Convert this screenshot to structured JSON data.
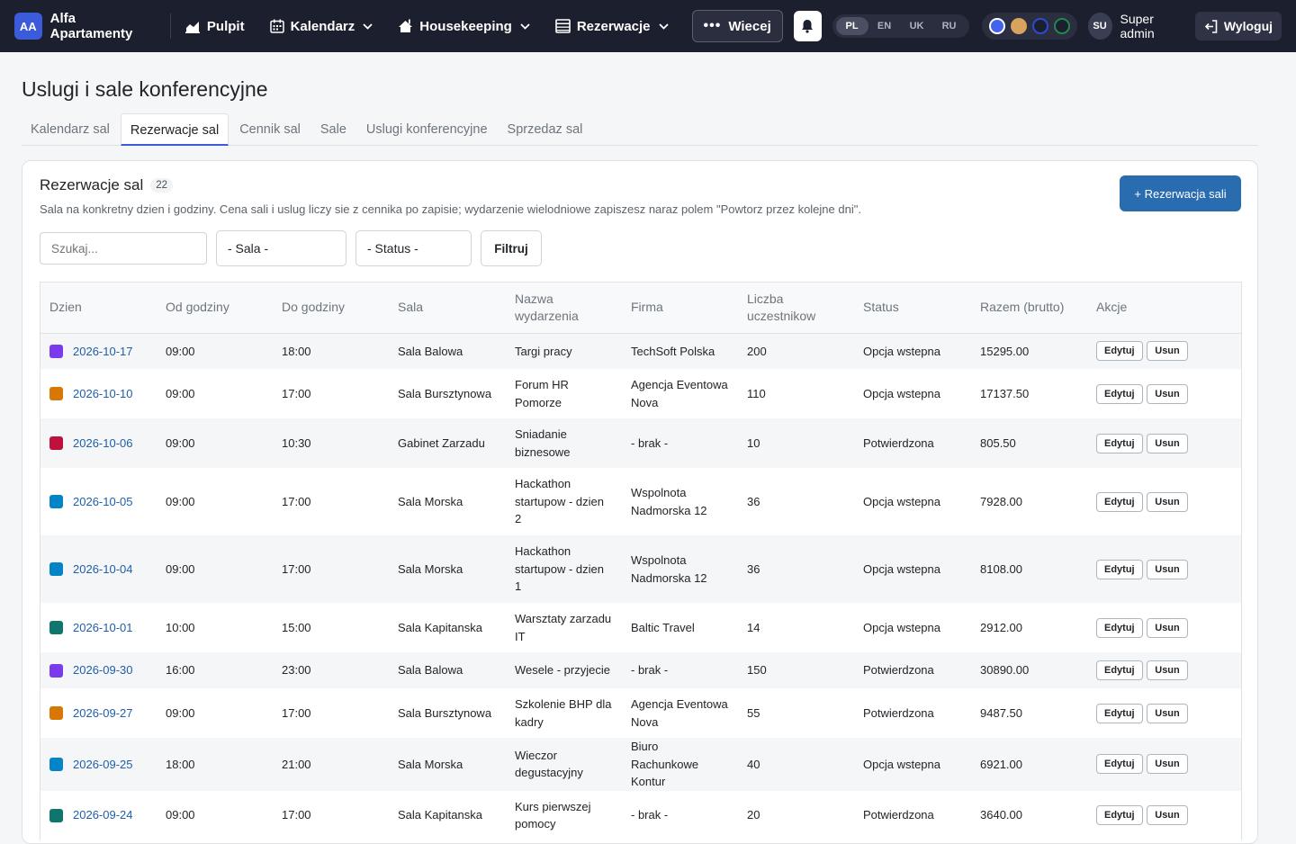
{
  "nav": {
    "brand_initials": "AA",
    "brand_name": "Alfa Apartamenty",
    "items": [
      {
        "label": "Pulpit"
      },
      {
        "label": "Kalendarz"
      },
      {
        "label": "Housekeeping"
      },
      {
        "label": "Rezerwacje"
      }
    ],
    "more_label": "Wiecej",
    "languages": [
      "PL",
      "EN",
      "UK",
      "RU"
    ],
    "active_language": "PL",
    "theme_colors": [
      "#4263eb",
      "#d9a25f",
      "#1c2fa8",
      "#1f8a4c"
    ],
    "user_initials": "SU",
    "user_name": "Super admin",
    "logout_label": "Wyloguj"
  },
  "page": {
    "title": "Uslugi i sale konferencyjne",
    "tabs": [
      {
        "label": "Kalendarz sal",
        "active": false
      },
      {
        "label": "Rezerwacje sal",
        "active": true
      },
      {
        "label": "Cennik sal",
        "active": false
      },
      {
        "label": "Sale",
        "active": false
      },
      {
        "label": "Uslugi konferencyjne",
        "active": false
      },
      {
        "label": "Sprzedaz sal",
        "active": false
      }
    ]
  },
  "card": {
    "title": "Rezerwacje sal",
    "count": "22",
    "description": "Sala na konkretny dzien i godziny. Cena sali i uslug liczy sie z cennika po zapisie; wydarzenie wielodniowe zapiszesz naraz polem \"Powtorz przez kolejne dni\".",
    "add_button": "+ Rezerwacja sali"
  },
  "filters": {
    "search_placeholder": "Szukaj...",
    "room_select": "- Sala -",
    "status_select": "- Status -",
    "filter_button": "Filtruj"
  },
  "table": {
    "headers": [
      "Dzien",
      "Od godziny",
      "Do godziny",
      "Sala",
      "Nazwa wydarzenia",
      "Firma",
      "Liczba uczestnikow",
      "Status",
      "Razem (brutto)",
      "Akcje"
    ],
    "edit_label": "Edytuj",
    "delete_label": "Usun",
    "rows": [
      {
        "color": "#7c3aed",
        "day": "2026-10-17",
        "from": "09:00",
        "to": "18:00",
        "room": "Sala Balowa",
        "event": "Targi pracy",
        "company": "TechSoft Polska",
        "participants": "200",
        "status": "Opcja wstepna",
        "total": "15295.00"
      },
      {
        "color": "#d97706",
        "day": "2026-10-10",
        "from": "09:00",
        "to": "17:00",
        "room": "Sala Bursztynowa",
        "event": "Forum HR Pomorze",
        "company": "Agencja Eventowa Nova",
        "participants": "110",
        "status": "Opcja wstepna",
        "total": "17137.50"
      },
      {
        "color": "#be123c",
        "day": "2026-10-06",
        "from": "09:00",
        "to": "10:30",
        "room": "Gabinet Zarzadu",
        "event": "Sniadanie biznesowe",
        "company": "- brak -",
        "participants": "10",
        "status": "Potwierdzona",
        "total": "805.50"
      },
      {
        "color": "#0284c7",
        "day": "2026-10-05",
        "from": "09:00",
        "to": "17:00",
        "room": "Sala Morska",
        "event": "Hackathon startupow - dzien 2",
        "company": "Wspolnota Nadmorska 12",
        "participants": "36",
        "status": "Opcja wstepna",
        "total": "7928.00"
      },
      {
        "color": "#0284c7",
        "day": "2026-10-04",
        "from": "09:00",
        "to": "17:00",
        "room": "Sala Morska",
        "event": "Hackathon startupow - dzien 1",
        "company": "Wspolnota Nadmorska 12",
        "participants": "36",
        "status": "Opcja wstepna",
        "total": "8108.00"
      },
      {
        "color": "#0f766e",
        "day": "2026-10-01",
        "from": "10:00",
        "to": "15:00",
        "room": "Sala Kapitanska",
        "event": "Warsztaty zarzadu IT",
        "company": "Baltic Travel",
        "participants": "14",
        "status": "Opcja wstepna",
        "total": "2912.00"
      },
      {
        "color": "#7c3aed",
        "day": "2026-09-30",
        "from": "16:00",
        "to": "23:00",
        "room": "Sala Balowa",
        "event": "Wesele - przyjecie",
        "company": "- brak -",
        "participants": "150",
        "status": "Potwierdzona",
        "total": "30890.00"
      },
      {
        "color": "#d97706",
        "day": "2026-09-27",
        "from": "09:00",
        "to": "17:00",
        "room": "Sala Bursztynowa",
        "event": "Szkolenie BHP dla kadry",
        "company": "Agencja Eventowa Nova",
        "participants": "55",
        "status": "Potwierdzona",
        "total": "9487.50"
      },
      {
        "color": "#0284c7",
        "day": "2026-09-25",
        "from": "18:00",
        "to": "21:00",
        "room": "Sala Morska",
        "event": "Wieczor degustacyjny",
        "company": "Biuro Rachunkowe Kontur",
        "participants": "40",
        "status": "Opcja wstepna",
        "total": "6921.00"
      },
      {
        "color": "#0f766e",
        "day": "2026-09-24",
        "from": "09:00",
        "to": "17:00",
        "room": "Sala Kapitanska",
        "event": "Kurs pierwszej pomocy",
        "company": "- brak -",
        "participants": "20",
        "status": "Potwierdzona",
        "total": "3640.00"
      }
    ]
  }
}
